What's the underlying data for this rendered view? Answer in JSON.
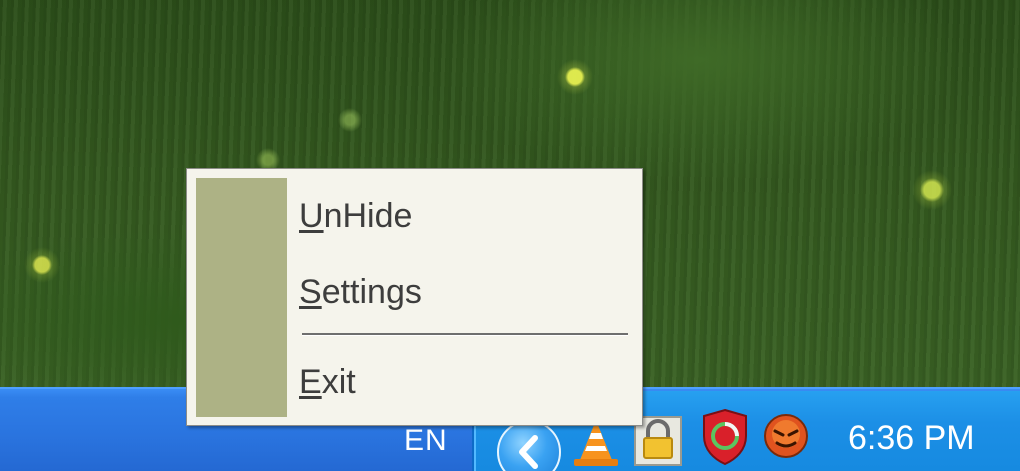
{
  "context_menu": {
    "items": [
      {
        "accel": "U",
        "rest": "nHide"
      },
      {
        "accel": "S",
        "rest": "ettings"
      },
      {
        "accel": "E",
        "rest": "xit"
      }
    ]
  },
  "taskbar": {
    "language": "EN",
    "clock": "6:36 PM",
    "tray_icons": [
      "show-hidden-icons-icon",
      "vlc-cone-icon",
      "lock-icon",
      "red-shield-icon",
      "red-face-icon"
    ]
  },
  "colors": {
    "menu_background": "#f5f4ec",
    "menu_sidebar": "#adb285",
    "taskbar": "#2a74df",
    "tray": "#1c8fe6"
  }
}
